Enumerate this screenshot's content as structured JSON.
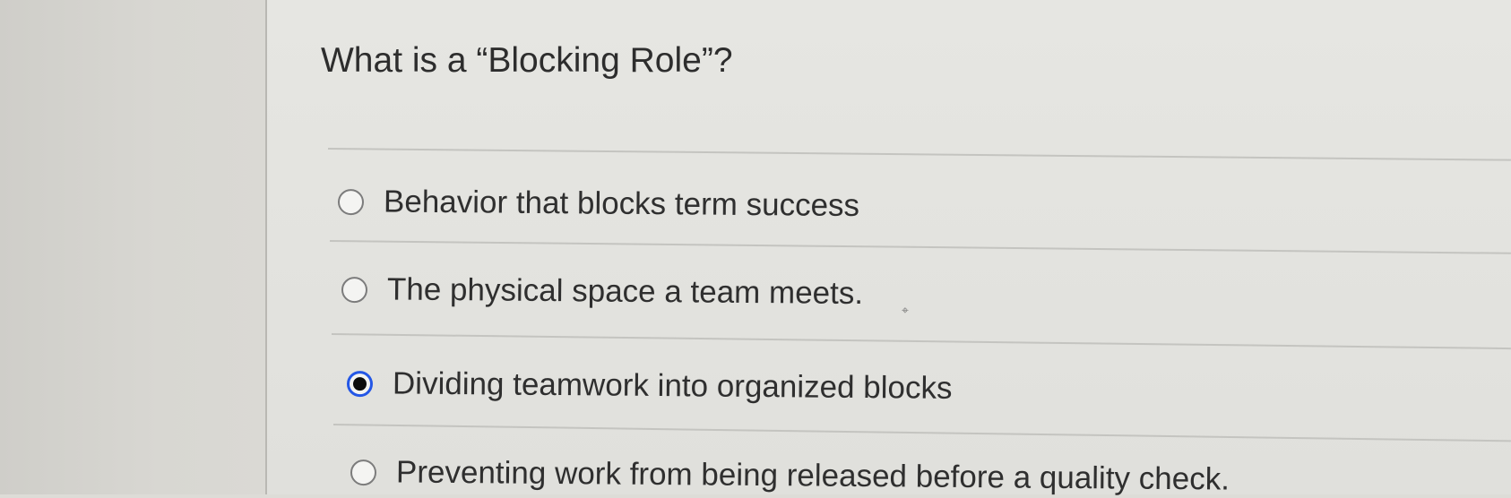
{
  "question": {
    "text": "What is a “Blocking Role”?"
  },
  "options": [
    {
      "label": "Behavior that blocks term success",
      "selected": false
    },
    {
      "label": "The physical space a team meets.",
      "selected": false
    },
    {
      "label": "Dividing teamwork into organized blocks",
      "selected": true
    },
    {
      "label": "Preventing work from being released before a quality check.",
      "selected": false
    }
  ],
  "colors": {
    "selected_radio": "#2457e6",
    "text": "#2f2f2f"
  }
}
